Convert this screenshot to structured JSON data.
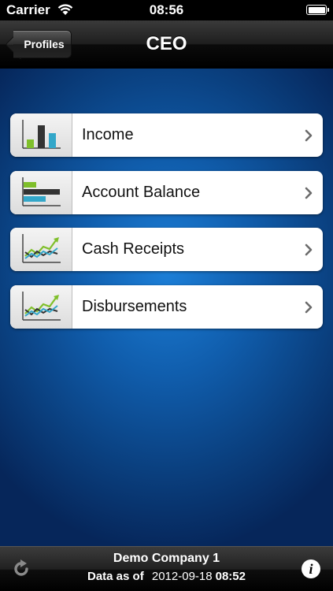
{
  "status_bar": {
    "carrier": "Carrier",
    "time": "08:56",
    "battery_level": 1.0
  },
  "nav": {
    "back_label": "Profiles",
    "title": "CEO"
  },
  "menu": {
    "items": [
      {
        "label": "Income",
        "icon": "bar-chart-icon"
      },
      {
        "label": "Account Balance",
        "icon": "horizontal-bar-chart-icon"
      },
      {
        "label": "Cash Receipts",
        "icon": "line-chart-icon"
      },
      {
        "label": "Disbursements",
        "icon": "line-chart-icon"
      }
    ]
  },
  "footer": {
    "company": "Demo Company 1",
    "data_as_of_label": "Data as of",
    "data_date": "2012-09-18",
    "data_time": "08:52",
    "info_symbol": "i"
  },
  "colors": {
    "background_center": "#1c7fd8",
    "background_edge": "#06265a",
    "icon_green": "#7fbf2a",
    "icon_teal": "#33a7c9",
    "icon_dark": "#333333"
  }
}
